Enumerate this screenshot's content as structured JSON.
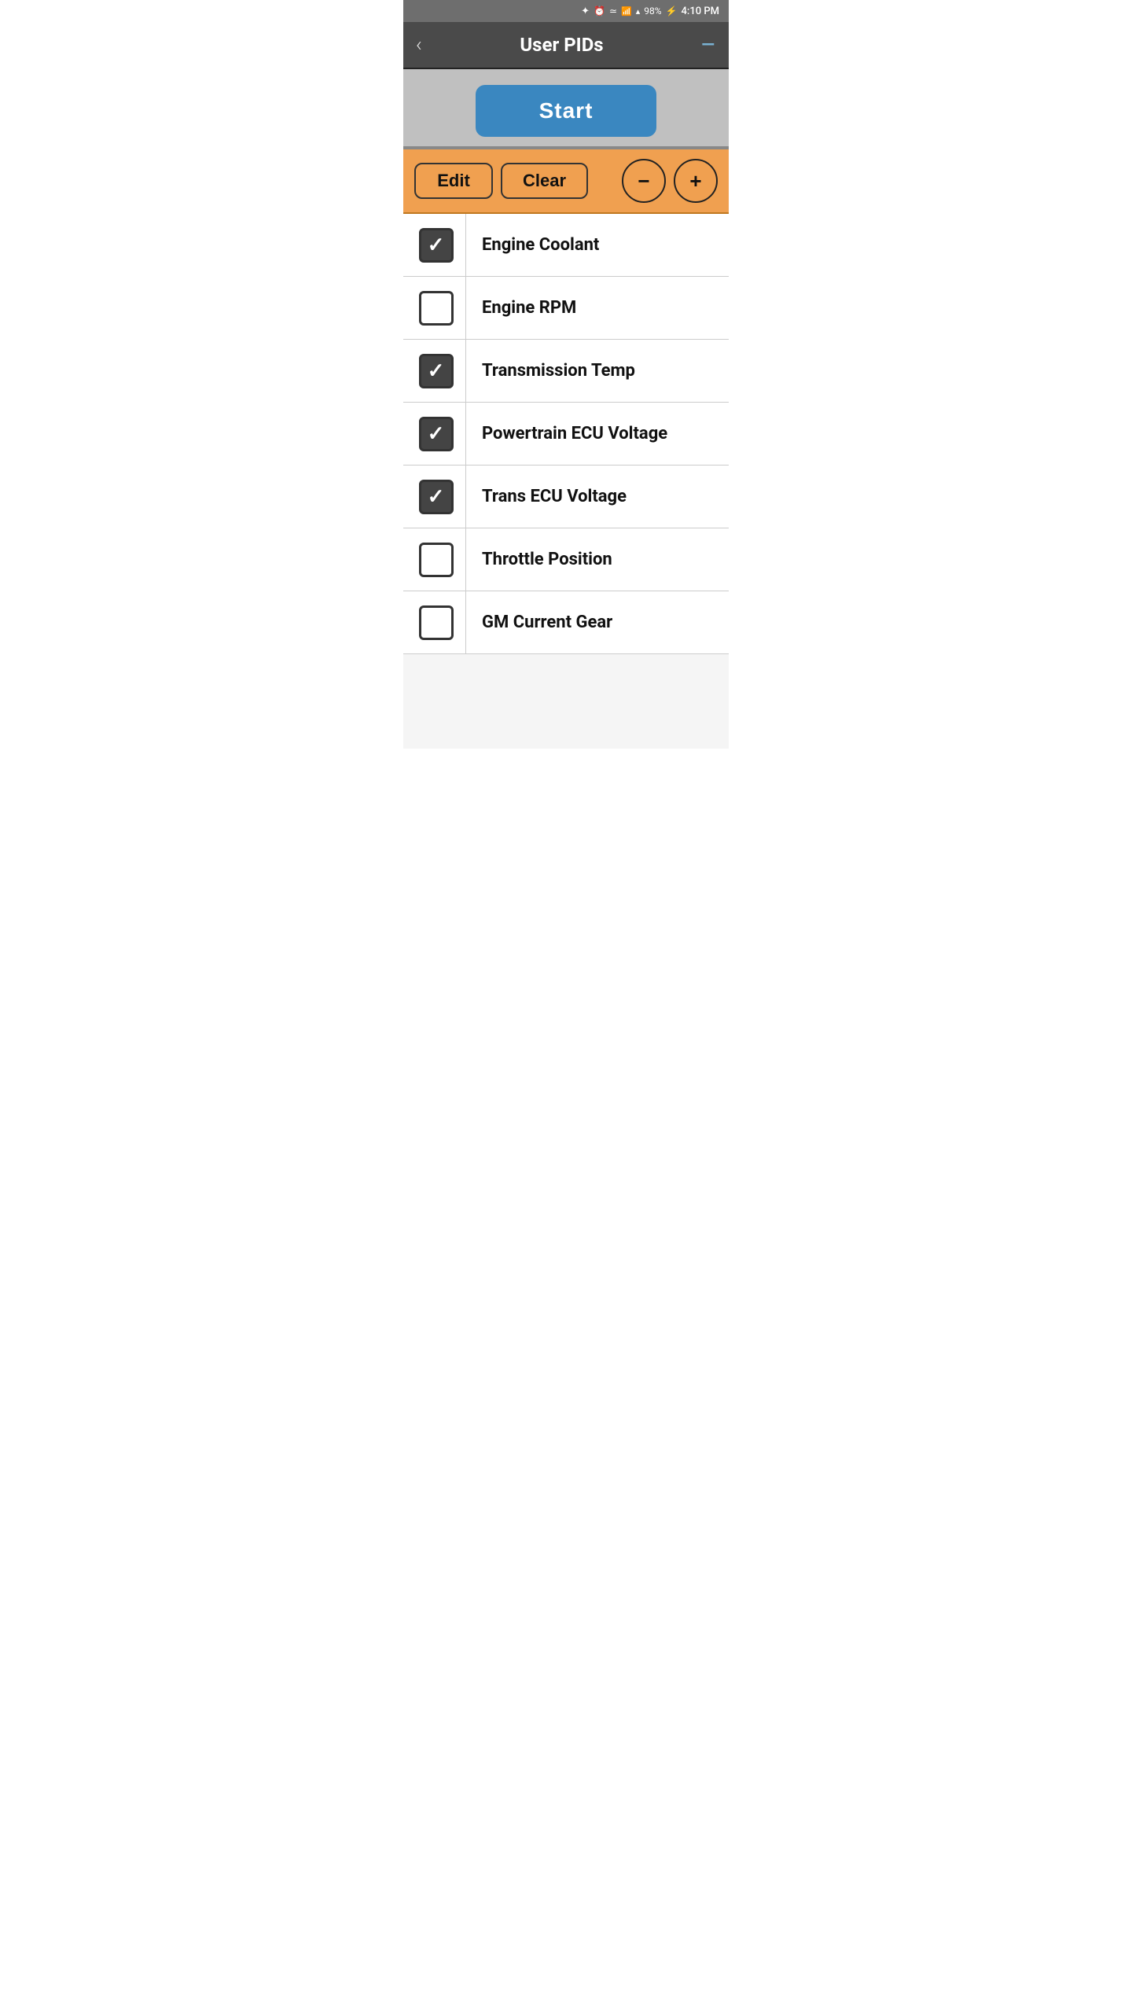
{
  "statusBar": {
    "time": "4:10 PM",
    "battery": "98%",
    "icons": [
      "bluetooth",
      "alarm",
      "wifi",
      "signal",
      "battery"
    ]
  },
  "header": {
    "title": "User PIDs",
    "backLabel": "‹",
    "menuLabel": "—"
  },
  "startButton": {
    "label": "Start"
  },
  "toolbar": {
    "editLabel": "Edit",
    "clearLabel": "Clear",
    "minusLabel": "−",
    "plusLabel": "+"
  },
  "pidItems": [
    {
      "id": 1,
      "label": "Engine Coolant",
      "checked": true
    },
    {
      "id": 2,
      "label": "Engine RPM",
      "checked": false
    },
    {
      "id": 3,
      "label": "Transmission Temp",
      "checked": true
    },
    {
      "id": 4,
      "label": "Powertrain ECU Voltage",
      "checked": true
    },
    {
      "id": 5,
      "label": "Trans ECU Voltage",
      "checked": true
    },
    {
      "id": 6,
      "label": "Throttle Position",
      "checked": false
    },
    {
      "id": 7,
      "label": "GM Current Gear",
      "checked": false
    }
  ],
  "colors": {
    "headerBg": "#4a4a4a",
    "startBg": "#c0c0c0",
    "startButtonBg": "#3a87c0",
    "toolbarBg": "#f0a050",
    "checkedBg": "#444444",
    "menuColor": "#7ab3d4"
  }
}
